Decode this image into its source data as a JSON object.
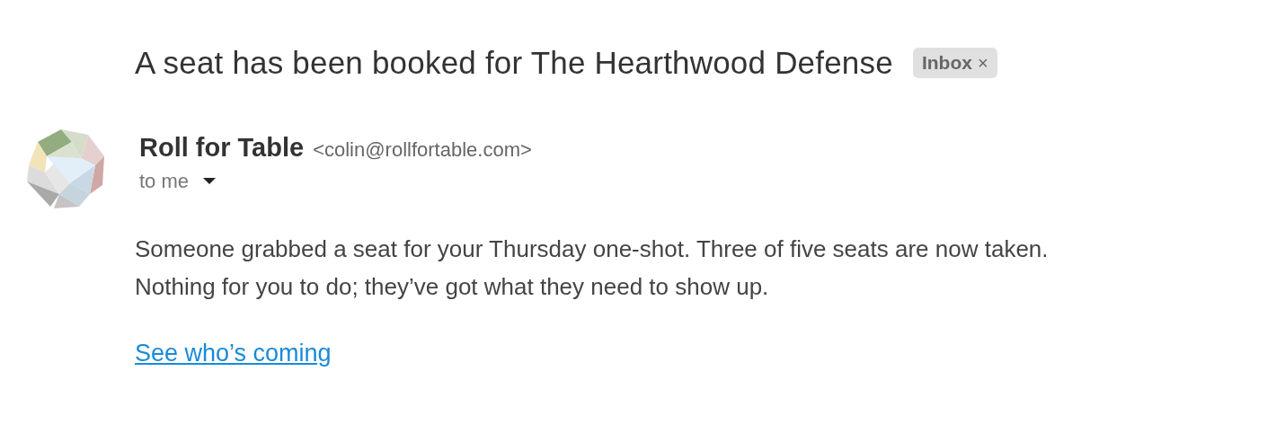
{
  "subject": "A seat has been booked for The Hearthwood Defense",
  "label": {
    "text": "Inbox",
    "remove": "×"
  },
  "sender": {
    "name": "Roll for Table",
    "email": "<colin@rollfortable.com>",
    "recipient": "to me"
  },
  "body": [
    "Someone grabbed a seat for your Thursday one-shot. Three of five seats are now taken.",
    "Nothing for you to do; they’ve got what they need to show up."
  ],
  "link": "See who’s coming"
}
